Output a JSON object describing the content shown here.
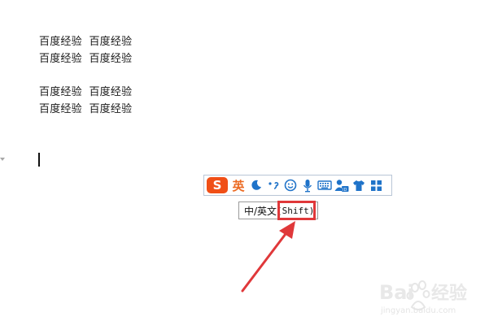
{
  "document": {
    "lines": [
      "百度经验  百度经验",
      "百度经验  百度经验",
      "百度经验  百度经验",
      "百度经验  百度经验"
    ]
  },
  "ime_toolbar": {
    "logo_letter": "S",
    "mode_label": "英",
    "icons": [
      "moon-icon",
      "punctuation-icon",
      "smiley-icon",
      "microphone-icon",
      "keyboard-icon",
      "user-icon",
      "shirt-icon",
      "grid-icon"
    ]
  },
  "tooltip": {
    "label": "中/英文",
    "shortcut": "(Shift)"
  },
  "annotation": {
    "highlight_color": "#e0383a",
    "arrow_color": "#e0383a"
  },
  "watermark": {
    "brand": "Bai 经验",
    "url": "jingyan.baidu.com"
  },
  "colors": {
    "ime_accent": "#f04f17",
    "ime_blue": "#1f73c9",
    "ime_border": "#b9c6d6"
  }
}
